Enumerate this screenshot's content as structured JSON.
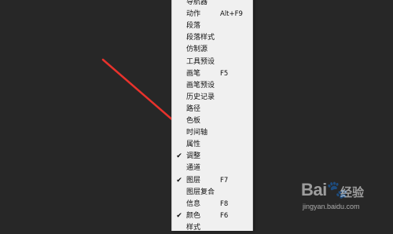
{
  "menu": {
    "items": [
      {
        "label": "导航器",
        "shortcut": "",
        "checked": false
      },
      {
        "label": "动作",
        "shortcut": "Alt+F9",
        "checked": false
      },
      {
        "label": "段落",
        "shortcut": "",
        "checked": false
      },
      {
        "label": "段落样式",
        "shortcut": "",
        "checked": false
      },
      {
        "label": "仿制源",
        "shortcut": "",
        "checked": false
      },
      {
        "label": "工具预设",
        "shortcut": "",
        "checked": false
      },
      {
        "label": "画笔",
        "shortcut": "F5",
        "checked": false
      },
      {
        "label": "画笔预设",
        "shortcut": "",
        "checked": false
      },
      {
        "label": "历史记录",
        "shortcut": "",
        "checked": false
      },
      {
        "label": "路径",
        "shortcut": "",
        "checked": false
      },
      {
        "label": "色板",
        "shortcut": "",
        "checked": false
      },
      {
        "label": "时间轴",
        "shortcut": "",
        "checked": false
      },
      {
        "label": "属性",
        "shortcut": "",
        "checked": false
      },
      {
        "label": "调整",
        "shortcut": "",
        "checked": true
      },
      {
        "label": "通道",
        "shortcut": "",
        "checked": false
      },
      {
        "label": "图层",
        "shortcut": "F7",
        "checked": true
      },
      {
        "label": "图层复合",
        "shortcut": "",
        "checked": false
      },
      {
        "label": "信息",
        "shortcut": "F8",
        "checked": false
      },
      {
        "label": "颜色",
        "shortcut": "F6",
        "checked": true
      },
      {
        "label": "样式",
        "shortcut": "",
        "checked": false
      }
    ],
    "check_glyph": "✔"
  },
  "annotation": {
    "arrow_color": "#e8322c"
  },
  "watermark": {
    "logo_text": "Bai🐾",
    "logo_suffix": "经验",
    "url": "jingyan.baidu.com"
  }
}
